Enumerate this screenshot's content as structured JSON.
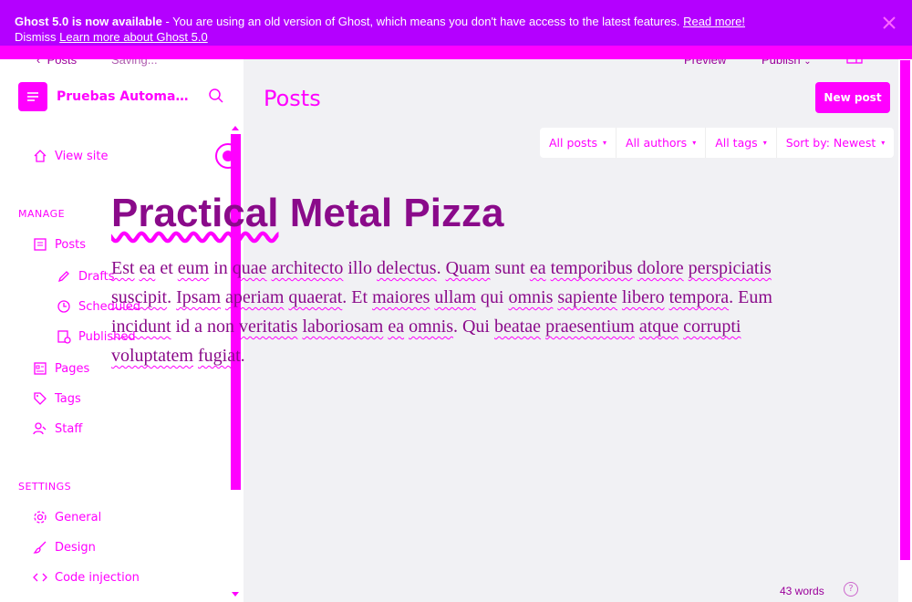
{
  "banner": {
    "headline": "Ghost 5.0 is now available",
    "message": " - You are using an old version of Ghost, which means you don't have access to the latest features.",
    "read_more": "Read more!",
    "second_line": "Dismiss",
    "learn_more": "Learn more about Ghost 5.0"
  },
  "editor": {
    "back_label": "Posts",
    "status": "Saving...",
    "preview_label": "Preview",
    "publish_label": "Publish",
    "title": "Practical Metal Pizza",
    "body": "Est ea et eum in quae architecto illo delectus. Quam sunt ea temporibus dolore perspiciatis suscipit. Ipsam aperiam quaerat. Et maiores ullam qui omnis sapiente libero tempora. Eum incidunt id a non veritatis laboriosam ea omnis. Qui beatae praesentium atque corrupti voluptatem fugiat.",
    "word_count": "43 words",
    "help": "?"
  },
  "sidebar": {
    "site_name": "Pruebas Automati...",
    "view_site": "View site",
    "manage_label": "MANAGE",
    "posts": "Posts",
    "drafts": "Drafts",
    "scheduled": "Scheduled",
    "published": "Published",
    "pages": "Pages",
    "tags": "Tags",
    "staff": "Staff",
    "settings_label": "SETTINGS",
    "general": "General",
    "design": "Design",
    "code_injection": "Code injection"
  },
  "main": {
    "title": "Posts",
    "new_post": "New post",
    "filters": [
      "All posts",
      "All authors",
      "All tags",
      "Sort by: Newest"
    ]
  },
  "colors": {
    "accent": "#ff00ff",
    "banner": "#b400ff",
    "editor_text": "#8a0a8a"
  }
}
